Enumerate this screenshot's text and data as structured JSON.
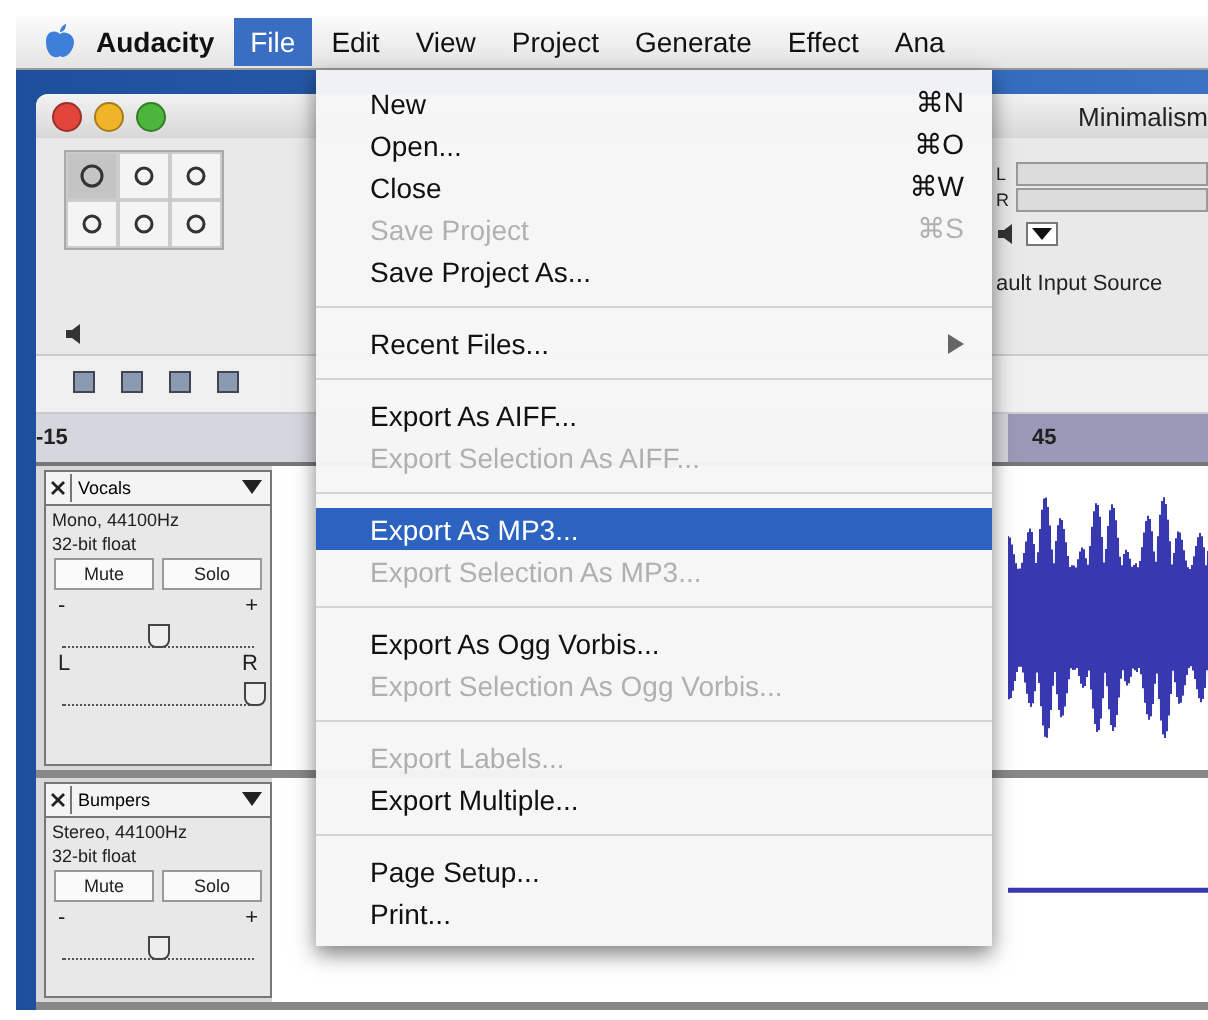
{
  "menubar": {
    "items": [
      {
        "label": "Audacity",
        "kind": "app",
        "selected": false
      },
      {
        "label": "File",
        "kind": "menu",
        "selected": true
      },
      {
        "label": "Edit",
        "kind": "menu",
        "selected": false
      },
      {
        "label": "View",
        "kind": "menu",
        "selected": false
      },
      {
        "label": "Project",
        "kind": "menu",
        "selected": false
      },
      {
        "label": "Generate",
        "kind": "menu",
        "selected": false
      },
      {
        "label": "Effect",
        "kind": "menu",
        "selected": false
      },
      {
        "label": "Ana",
        "kind": "menu",
        "selected": false
      }
    ]
  },
  "window": {
    "title": "Minimalism",
    "meter_labels": [
      "L",
      "R"
    ],
    "input_source": "ault Input Source"
  },
  "ruler": {
    "left_tick": "-15",
    "right_tick": "45"
  },
  "tracks": [
    {
      "name": "Vocals",
      "format": "Mono, 44100Hz",
      "sample_format": "32-bit float",
      "mute": "Mute",
      "solo": "Solo",
      "gain_min": "-",
      "gain_max": "+",
      "gain": {
        "level": 0.5
      },
      "pan_left": "L",
      "pan_right": "R",
      "pan": {
        "level": 1
      }
    },
    {
      "name": "Bumpers",
      "format": "Stereo, 44100Hz",
      "sample_format": "32-bit float",
      "mute": "Mute",
      "solo": "Solo",
      "gain_min": "-",
      "gain_max": "+",
      "gain": {
        "level": 0.5
      }
    }
  ],
  "file_menu": {
    "items": [
      {
        "kind": "item",
        "label": "New",
        "shortcut": "⌘N",
        "disabled": false,
        "selected": false
      },
      {
        "kind": "item",
        "label": "Open...",
        "shortcut": "⌘O",
        "disabled": false,
        "selected": false
      },
      {
        "kind": "item",
        "label": "Close",
        "shortcut": "⌘W",
        "disabled": false,
        "selected": false
      },
      {
        "kind": "item",
        "label": "Save Project",
        "shortcut": "⌘S",
        "disabled": true,
        "selected": false
      },
      {
        "kind": "item",
        "label": "Save Project As...",
        "disabled": false,
        "selected": false
      },
      {
        "kind": "separator"
      },
      {
        "kind": "item",
        "label": "Recent Files...",
        "submenu": true,
        "disabled": false,
        "selected": false
      },
      {
        "kind": "separator"
      },
      {
        "kind": "item",
        "label": "Export As AIFF...",
        "disabled": false,
        "selected": false
      },
      {
        "kind": "item",
        "label": "Export Selection As AIFF...",
        "disabled": true,
        "selected": false
      },
      {
        "kind": "separator"
      },
      {
        "kind": "item",
        "label": "Export As MP3...",
        "disabled": false,
        "selected": true
      },
      {
        "kind": "item",
        "label": "Export Selection As MP3...",
        "disabled": true,
        "selected": false
      },
      {
        "kind": "separator"
      },
      {
        "kind": "item",
        "label": "Export As Ogg Vorbis...",
        "disabled": false,
        "selected": false
      },
      {
        "kind": "item",
        "label": "Export Selection As Ogg Vorbis...",
        "disabled": true,
        "selected": false
      },
      {
        "kind": "separator"
      },
      {
        "kind": "item",
        "label": "Export Labels...",
        "disabled": true,
        "selected": false
      },
      {
        "kind": "item",
        "label": "Export Multiple...",
        "disabled": false,
        "selected": false
      },
      {
        "kind": "separator"
      },
      {
        "kind": "item",
        "label": "Page Setup...",
        "disabled": false,
        "selected": false
      },
      {
        "kind": "item",
        "label": "Print...",
        "disabled": false,
        "selected": false
      }
    ]
  }
}
